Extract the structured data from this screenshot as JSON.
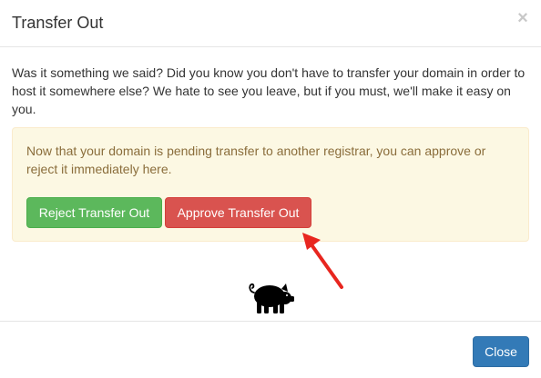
{
  "modal": {
    "title": "Transfer Out",
    "close_glyph": "×",
    "intro_text": "Was it something we said? Did you know you don't have to transfer your domain in order to host it somewhere else? We hate to see you leave, but if you must, we'll make it easy on you.",
    "alert": {
      "text": "Now that your domain is pending transfer to another registrar, you can approve or reject it immediately here.",
      "reject_label": "Reject Transfer Out",
      "approve_label": "Approve Transfer Out"
    },
    "footer": {
      "close_label": "Close"
    }
  },
  "colors": {
    "reject_button": "#5cb85c",
    "approve_button": "#d9534f",
    "close_button": "#337ab7",
    "alert_background": "#fcf8e3",
    "alert_text": "#8a6d3b",
    "annotation_arrow": "#e8261f"
  },
  "icons": {
    "dismiss": "close-icon",
    "mascot": "pig-icon",
    "annotation": "red-arrow-icon"
  }
}
